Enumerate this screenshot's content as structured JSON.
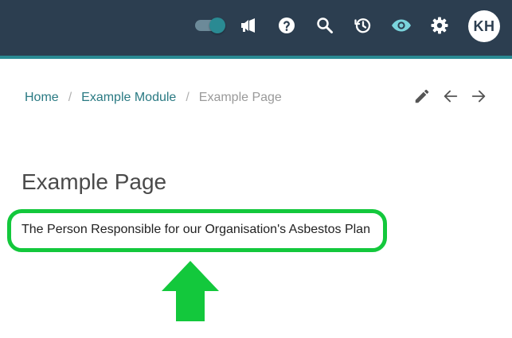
{
  "topbar": {
    "background": "#2c3e50",
    "accent": "#2a8a93",
    "toggle": {
      "name": "toggle",
      "state": "on"
    },
    "icons": [
      "megaphone-icon",
      "help-icon",
      "search-icon",
      "history-icon",
      "eye-icon",
      "gear-icon"
    ],
    "avatar": {
      "initials": "KH"
    }
  },
  "breadcrumb": {
    "home": "Home",
    "separator": "/",
    "module": "Example Module",
    "current": "Example Page"
  },
  "actions": [
    "pencil-icon",
    "arrow-left-icon",
    "arrow-right-icon"
  ],
  "page": {
    "title": "Example Page",
    "text": "The Person Responsible for our Organisation's Asbestos Plan"
  },
  "annotation": {
    "highlight_color": "#13c83c",
    "arrow_color": "#13c83c"
  }
}
